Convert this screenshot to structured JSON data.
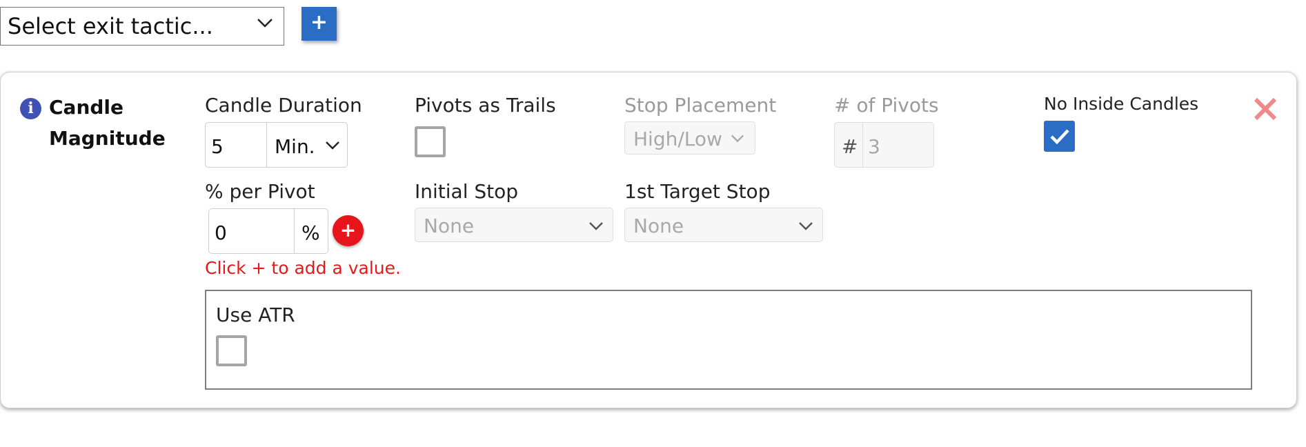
{
  "toolbar": {
    "tactic_select_value": "Select exit tactic...",
    "add_button_label": "+"
  },
  "card": {
    "title_line1": "Candle",
    "title_line2": "Magnitude",
    "info_icon_glyph": "i",
    "candle_duration": {
      "label": "Candle Duration",
      "value": "5",
      "unit": "Min."
    },
    "pivots_as_trails": {
      "label": "Pivots as Trails",
      "checked": false
    },
    "stop_placement": {
      "label": "Stop Placement",
      "value": "High/Low",
      "disabled": true
    },
    "num_pivots": {
      "label": "# of Pivots",
      "prefix": "#",
      "value": "3",
      "disabled": true
    },
    "no_inside_candles": {
      "label": "No Inside Candles",
      "checked": true
    },
    "percent_per_pivot": {
      "label": "% per Pivot",
      "value": "0",
      "suffix": "%",
      "add_label": "+",
      "hint": "Click + to add a value."
    },
    "initial_stop": {
      "label": "Initial Stop",
      "value": "None",
      "disabled": true
    },
    "first_target_stop": {
      "label": "1st Target Stop",
      "value": "None",
      "disabled": true
    },
    "use_atr": {
      "label": "Use ATR",
      "checked": false
    }
  },
  "colors": {
    "accent_blue": "#2b6cc4",
    "info_icon": "#3f51b5",
    "danger_red": "#e8141c",
    "close_pink": "#f08a8a",
    "hint_red": "#e81818"
  },
  "icons": {
    "close": "close-icon",
    "chevron": "chevron-down-icon",
    "check": "checkmark-icon",
    "info": "info-icon",
    "plus": "plus-icon"
  }
}
